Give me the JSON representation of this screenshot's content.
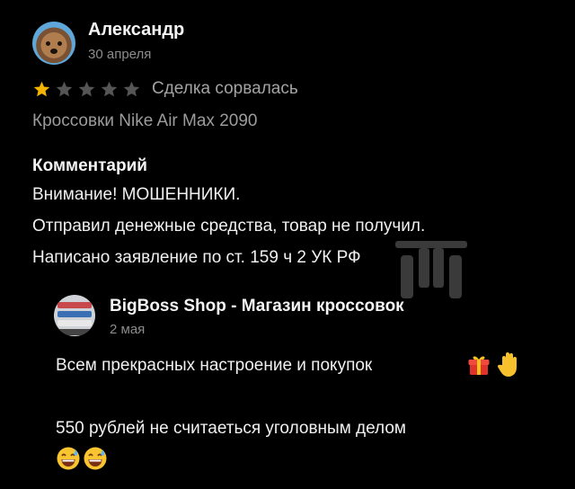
{
  "review": {
    "author": {
      "name": "Александр",
      "date": "30 апреля"
    },
    "rating": {
      "value": 1,
      "max": 5,
      "filled_color": "#f5b400",
      "empty_color": "#555555"
    },
    "deal_status": "Сделка сорвалась",
    "product": "Кроссовки Nike Air Max 2090",
    "comment": {
      "heading": "Комментарий",
      "lines": [
        "Внимание! МОШЕННИКИ.",
        "Отправил денежные средства, товар не получил.",
        "Написано заявление по ст. 159 ч 2 УК РФ"
      ]
    }
  },
  "reply": {
    "seller": {
      "name": "BigBoss Shop - Магазин кроссовок",
      "date": "2 мая"
    },
    "lines": [
      "Всем прекрасных настроение и покупок",
      "550 рублей не считаеться уголовным делом"
    ],
    "emojis": [
      "gift-icon",
      "raised-hand-icon",
      "sweat-smile-icon",
      "sweat-smile-icon"
    ]
  }
}
